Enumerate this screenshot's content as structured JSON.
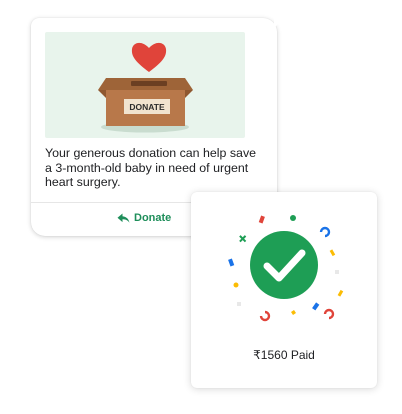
{
  "message_card": {
    "illustration": {
      "box_label": "DONATE",
      "colors": {
        "background": "#e8f4ec",
        "box": "#b8784a",
        "heart": "#e0443a"
      }
    },
    "text": "Your generous donation can help save a 3-month-old baby in need of urgent heart surgery.",
    "action": {
      "label": "Donate",
      "icon": "reply-arrow-icon"
    }
  },
  "payment_card": {
    "icon": "check-circle-icon",
    "paid_text": "₹1560 Paid",
    "colors": {
      "check": "#1e9e55",
      "accent": "#1e8e5a"
    }
  }
}
